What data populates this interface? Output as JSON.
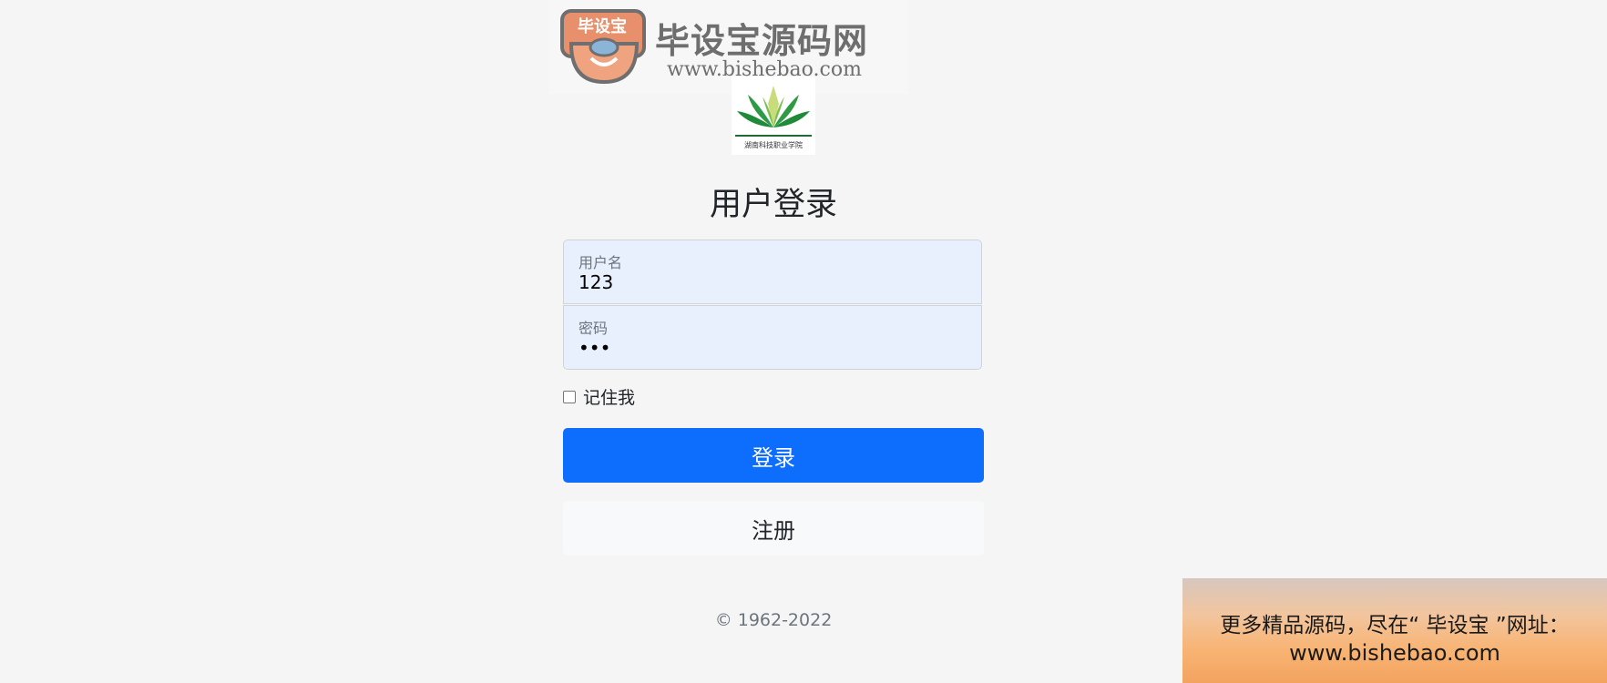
{
  "watermark": {
    "badge_text": "毕设宝",
    "title": "毕设宝源码网",
    "url": "www.bishebao.com"
  },
  "emblem": {
    "caption": "湖南科技职业学院"
  },
  "login": {
    "title": "用户登录",
    "username_label": "用户名",
    "username_value": "123",
    "password_label": "密码",
    "password_value": "•••",
    "remember_label": "记住我",
    "remember_checked": false,
    "login_button": "登录",
    "register_button": "注册",
    "copyright": "© 1962-2022"
  },
  "ad": {
    "line1": "更多精品源码，尽在“ 毕设宝 ”网址：",
    "line2": "www.bishebao.com"
  },
  "colors": {
    "primary": "#0d6efd",
    "field_bg": "#e8f0fe",
    "page_bg": "#f5f5f5"
  }
}
